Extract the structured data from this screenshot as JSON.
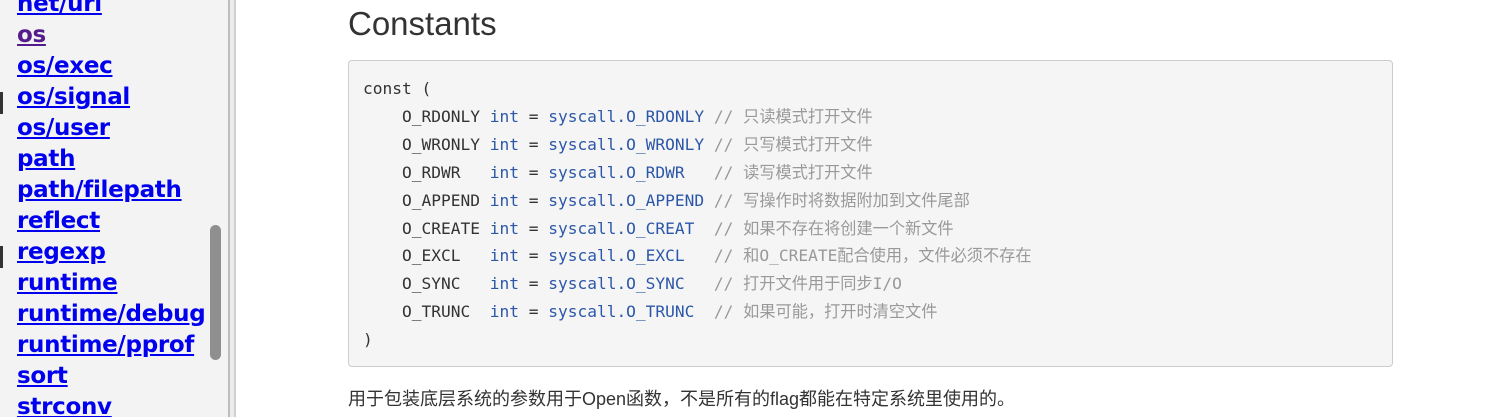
{
  "sidebar": {
    "items": [
      {
        "label": "net/url",
        "visited": false
      },
      {
        "label": "os",
        "visited": true
      },
      {
        "label": "os/exec",
        "visited": false
      },
      {
        "label": "os/signal",
        "visited": false
      },
      {
        "label": "os/user",
        "visited": false
      },
      {
        "label": "path",
        "visited": false
      },
      {
        "label": "path/filepath",
        "visited": false
      },
      {
        "label": "reflect",
        "visited": false
      },
      {
        "label": "regexp",
        "visited": false
      },
      {
        "label": "runtime",
        "visited": false
      },
      {
        "label": "runtime/debug",
        "visited": false
      },
      {
        "label": "runtime/pprof",
        "visited": false
      },
      {
        "label": "sort",
        "visited": false
      },
      {
        "label": "strconv",
        "visited": false
      }
    ]
  },
  "main": {
    "title": "Constants",
    "code": {
      "open": "const (",
      "close": ")",
      "lines": [
        {
          "name": "O_RDONLY",
          "type": "int",
          "eq": "=",
          "value": "syscall.O_RDONLY",
          "comment": "// 只读模式打开文件"
        },
        {
          "name": "O_WRONLY",
          "type": "int",
          "eq": "=",
          "value": "syscall.O_WRONLY",
          "comment": "// 只写模式打开文件"
        },
        {
          "name": "O_RDWR",
          "type": "int",
          "eq": "=",
          "value": "syscall.O_RDWR",
          "comment": "// 读写模式打开文件"
        },
        {
          "name": "O_APPEND",
          "type": "int",
          "eq": "=",
          "value": "syscall.O_APPEND",
          "comment": "// 写操作时将数据附加到文件尾部"
        },
        {
          "name": "O_CREATE",
          "type": "int",
          "eq": "=",
          "value": "syscall.O_CREAT",
          "comment": "// 如果不存在将创建一个新文件"
        },
        {
          "name": "O_EXCL",
          "type": "int",
          "eq": "=",
          "value": "syscall.O_EXCL",
          "comment": "// 和O_CREATE配合使用，文件必须不存在"
        },
        {
          "name": "O_SYNC",
          "type": "int",
          "eq": "=",
          "value": "syscall.O_SYNC",
          "comment": "// 打开文件用于同步I/O"
        },
        {
          "name": "O_TRUNC",
          "type": "int",
          "eq": "=",
          "value": "syscall.O_TRUNC",
          "comment": "// 如果可能，打开时清空文件"
        }
      ]
    },
    "description": "用于包装底层系统的参数用于Open函数，不是所有的flag都能在特定系统里使用的。"
  },
  "colors": {
    "link": "#0000ee",
    "link_visited": "#551a8b",
    "type_keyword": "#2c57a8",
    "comment": "#999999",
    "code_background": "#f5f5f5"
  }
}
